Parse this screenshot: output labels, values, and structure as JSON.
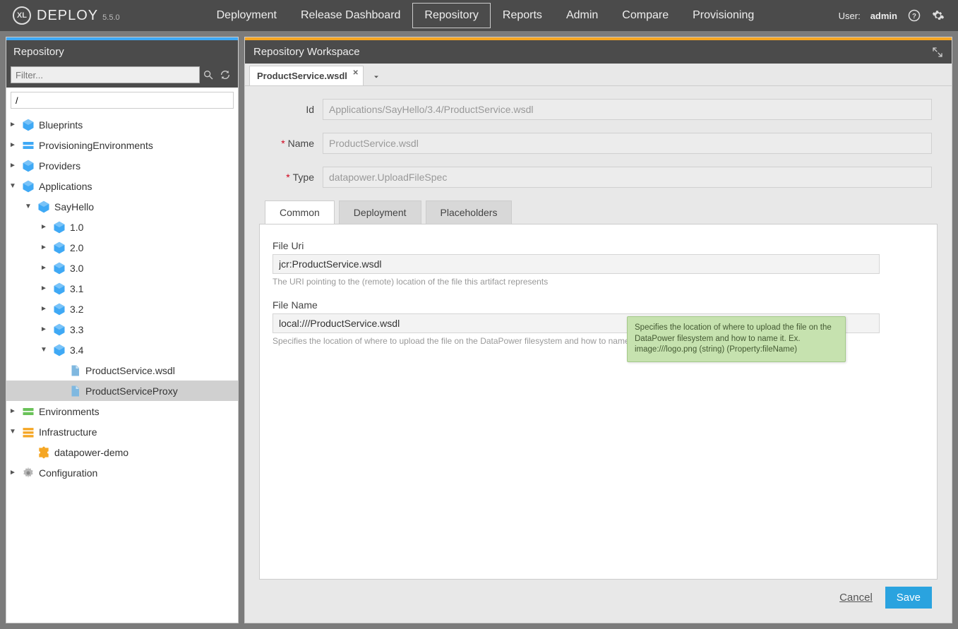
{
  "brand": {
    "logo_text": "XL",
    "name": "DEPLOY",
    "version": "5.5.0"
  },
  "topnav": {
    "items": [
      "Deployment",
      "Release Dashboard",
      "Repository",
      "Reports",
      "Admin",
      "Compare",
      "Provisioning"
    ],
    "active": "Repository"
  },
  "user": {
    "label": "User:",
    "name": "admin"
  },
  "sidebar": {
    "title": "Repository",
    "filter_placeholder": "Filter...",
    "path_value": "/",
    "tree": [
      {
        "label": "Blueprints",
        "icon": "blueprint",
        "indent": 0,
        "expander": "►"
      },
      {
        "label": "ProvisioningEnvironments",
        "icon": "env",
        "indent": 0,
        "expander": "►"
      },
      {
        "label": "Providers",
        "icon": "provider",
        "indent": 0,
        "expander": "►"
      },
      {
        "label": "Applications",
        "icon": "package",
        "indent": 0,
        "expander": "▼"
      },
      {
        "label": "SayHello",
        "icon": "package",
        "indent": 1,
        "expander": "▼"
      },
      {
        "label": "1.0",
        "icon": "package",
        "indent": 2,
        "expander": "►"
      },
      {
        "label": "2.0",
        "icon": "package",
        "indent": 2,
        "expander": "►"
      },
      {
        "label": "3.0",
        "icon": "package",
        "indent": 2,
        "expander": "►"
      },
      {
        "label": "3.1",
        "icon": "package",
        "indent": 2,
        "expander": "►"
      },
      {
        "label": "3.2",
        "icon": "package",
        "indent": 2,
        "expander": "►"
      },
      {
        "label": "3.3",
        "icon": "package",
        "indent": 2,
        "expander": "►"
      },
      {
        "label": "3.4",
        "icon": "package",
        "indent": 2,
        "expander": "▼"
      },
      {
        "label": "ProductService.wsdl",
        "icon": "file",
        "indent": 3,
        "expander": ""
      },
      {
        "label": "ProductServiceProxy",
        "icon": "file",
        "indent": 3,
        "expander": "",
        "selected": true
      },
      {
        "label": "Environments",
        "icon": "env-green",
        "indent": 0,
        "expander": "►"
      },
      {
        "label": "Infrastructure",
        "icon": "infra",
        "indent": 0,
        "expander": "▼"
      },
      {
        "label": "datapower-demo",
        "icon": "puzzle",
        "indent": 1,
        "expander": ""
      },
      {
        "label": "Configuration",
        "icon": "gear",
        "indent": 0,
        "expander": "►"
      }
    ]
  },
  "workspace": {
    "title": "Repository Workspace",
    "tab_label": "ProductService.wsdl",
    "form": {
      "id_label": "Id",
      "id_value": "Applications/SayHello/3.4/ProductService.wsdl",
      "name_label": "Name",
      "name_value": "ProductService.wsdl",
      "type_label": "Type",
      "type_value": "datapower.UploadFileSpec"
    },
    "subtabs": [
      "Common",
      "Deployment",
      "Placeholders"
    ],
    "subtab_active": "Common",
    "common": {
      "file_uri_label": "File Uri",
      "file_uri_value": "jcr:ProductService.wsdl",
      "file_uri_help": "The URI pointing to the (remote) location of the file this artifact represents",
      "file_name_label": "File Name",
      "file_name_value": "local:///ProductService.wsdl",
      "file_name_help": "Specifies the location of where to upload the file on the DataPower filesystem and how to name it. Ex.",
      "tooltip": "Specifies the location of where to upload the file on the DataPower filesystem and how to name it. Ex. image:///logo.png (string) (Property:fileName)"
    },
    "buttons": {
      "cancel": "Cancel",
      "save": "Save"
    }
  }
}
